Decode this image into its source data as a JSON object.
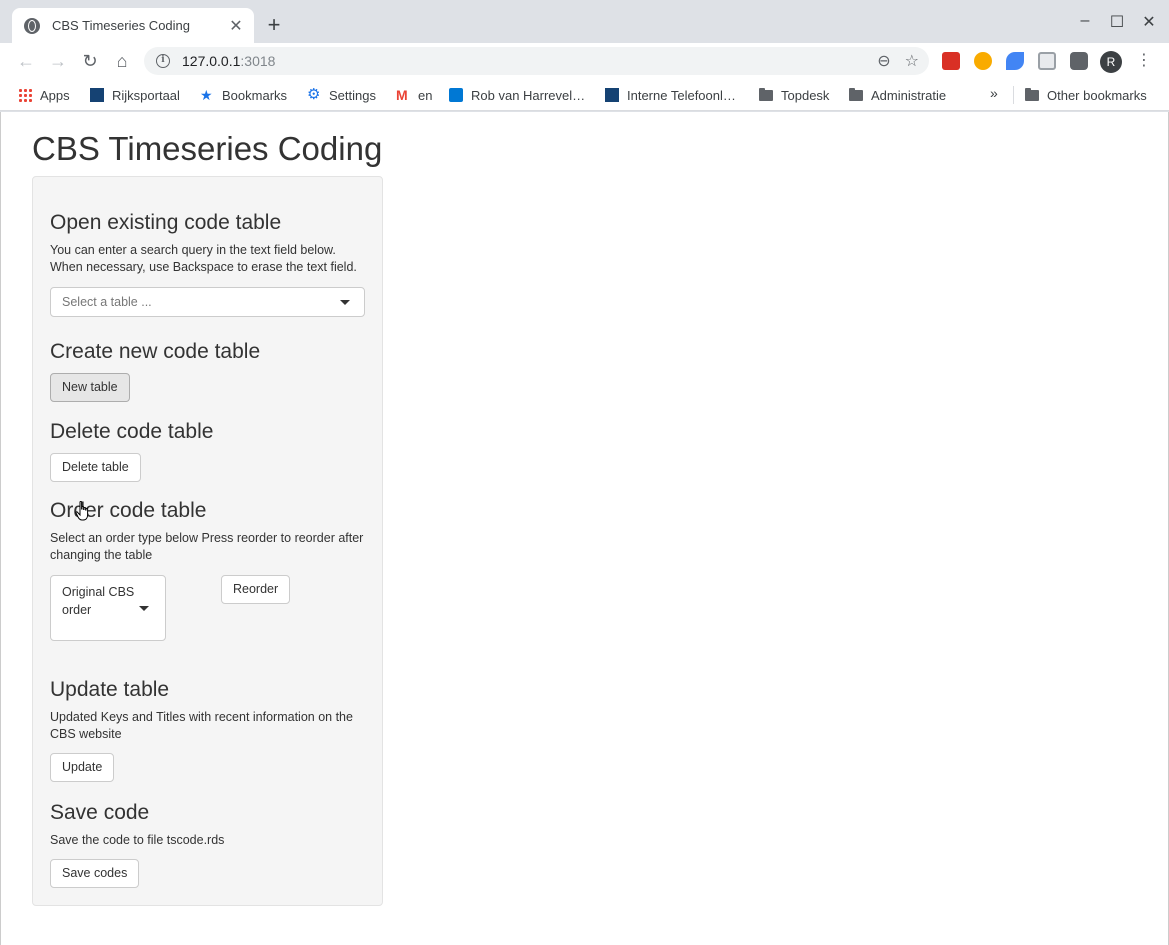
{
  "browser": {
    "tab_title": "CBS Timeseries Coding",
    "url_host": "127.0.0.1",
    "url_port": ":3018",
    "avatar_letter": "R",
    "bookmarks": [
      {
        "label": "Apps",
        "icon": "apps-grid-icon"
      },
      {
        "label": "Rijksportaal",
        "icon": "rijksoverheid-icon"
      },
      {
        "label": "Bookmarks",
        "icon": "star-icon"
      },
      {
        "label": "Settings",
        "icon": "gear-icon"
      },
      {
        "label": "en",
        "icon": "gmail-icon"
      },
      {
        "label": "Rob van Harrevel…",
        "icon": "outlook-icon"
      },
      {
        "label": "Interne Telefoonl…",
        "icon": "rijksoverheid-icon"
      },
      {
        "label": "Topdesk",
        "icon": "folder-icon"
      },
      {
        "label": "Administratie",
        "icon": "folder-icon"
      }
    ],
    "other_bookmarks": "Other bookmarks",
    "colors": {
      "accent": "#1a73e8",
      "chrome_bg": "#dee1e6"
    }
  },
  "app": {
    "title": "CBS Timeseries Coding",
    "open": {
      "heading": "Open existing code table",
      "help": "You can enter a search query in the text field below. When necessary, use Backspace to erase the text field.",
      "select_placeholder": "Select a table ..."
    },
    "create": {
      "heading": "Create new code table",
      "button": "New table"
    },
    "delete": {
      "heading": "Delete code table",
      "button": "Delete table"
    },
    "order": {
      "heading": "Order code table",
      "help": "Select an order type below Press reorder to reorder after changing the table",
      "selected": "Original CBS order",
      "button": "Reorder"
    },
    "update": {
      "heading": "Update table",
      "help": "Updated Keys and Titles with recent information on the CBS website",
      "button": "Update"
    },
    "save": {
      "heading": "Save code",
      "help": "Save the code to file tscode.rds",
      "button": "Save codes"
    }
  }
}
